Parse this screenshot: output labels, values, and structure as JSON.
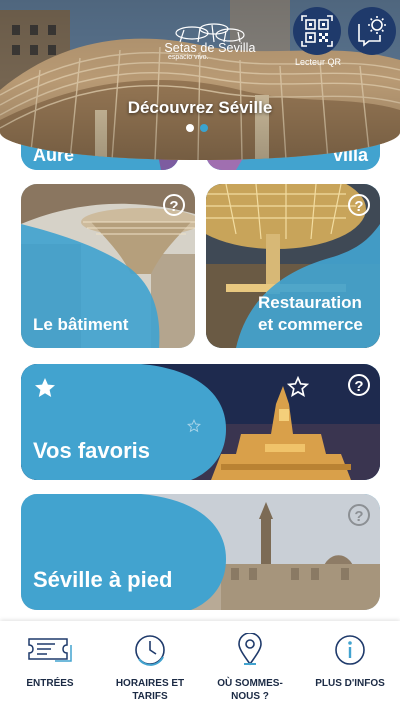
{
  "header": {
    "logo_name": "Setas de Sevilla",
    "logo_tagline": "espacio vivo.",
    "carousel_title": "Découvrez Séville",
    "qr_label": "Lecteur QR",
    "carousel": {
      "slides": 2,
      "active": 2
    }
  },
  "cards": {
    "partial_left": "Aure",
    "partial_right": "villa",
    "batiment": "Le bâtiment",
    "restauration": "Restauration et commerce",
    "favoris": "Vos favoris",
    "pied": "Séville à pied",
    "help_glyph": "?"
  },
  "tabbar": {
    "entrees": "ENTRÉES",
    "horaires": "HORAIRES ET TARIFS",
    "ou": "OÙ SOMMES-NOUS ?",
    "plus": "PLUS D'INFOS"
  },
  "colors": {
    "accent": "#42a3cf",
    "navy": "#1f3a6b",
    "text_dark": "#1b2a44"
  },
  "icons": [
    "qr-code-icon",
    "settings-gear-icon",
    "help-icon",
    "star-icon",
    "ticket-icon",
    "clock-icon",
    "location-pin-icon",
    "info-icon"
  ]
}
